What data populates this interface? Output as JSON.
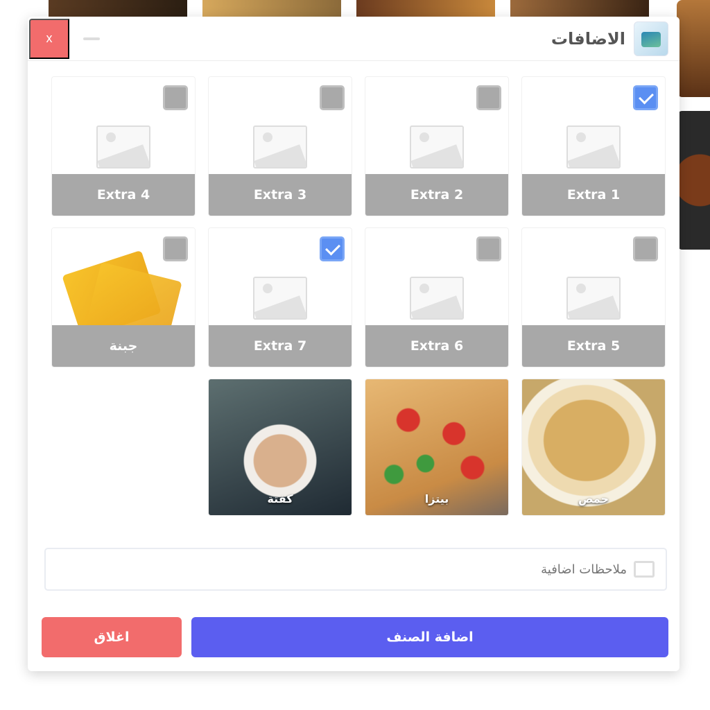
{
  "header": {
    "title": "الاضافات",
    "close_symbol": "x"
  },
  "grid": {
    "items": [
      {
        "label": "Extra 1",
        "checked": true,
        "image": "placeholder-icon"
      },
      {
        "label": "Extra 2",
        "checked": false,
        "image": "placeholder-icon"
      },
      {
        "label": "Extra 3",
        "checked": false,
        "image": "placeholder-icon"
      },
      {
        "label": "Extra 4",
        "checked": false,
        "image": "placeholder-icon"
      },
      {
        "label": "Extra 5",
        "checked": false,
        "image": "placeholder-icon"
      },
      {
        "label": "Extra 6",
        "checked": false,
        "image": "placeholder-icon"
      },
      {
        "label": "Extra 7",
        "checked": true,
        "image": "placeholder-icon"
      },
      {
        "label": "جبنة",
        "checked": false,
        "image": "cheese-photo"
      },
      {
        "label": "حمص",
        "image": "hummus-photo"
      },
      {
        "label": "بيتزا",
        "image": "pizza-photo"
      },
      {
        "label": "كفتة",
        "image": "meatball-photo"
      }
    ]
  },
  "note": {
    "placeholder": "ملاحظات اضافية",
    "icon": "note-icon"
  },
  "buttons": {
    "add_label": "اضافة الصنف",
    "close_label": "اغلاق"
  },
  "colors": {
    "accent": "#5b5ef0",
    "danger": "#f26c6c",
    "checked": "#5b8ff2",
    "label_bg": "#a8a8a8"
  }
}
